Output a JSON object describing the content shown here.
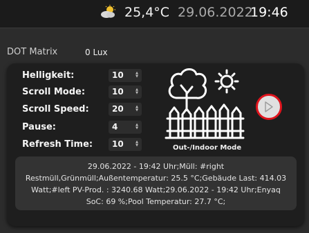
{
  "header": {
    "weather_icon": "partly-cloudy-icon",
    "temperature": "25,4°C",
    "date": "29.06.2022",
    "time": "19:46"
  },
  "dot_matrix": {
    "title": "DOT Matrix",
    "lux": "0 Lux",
    "settings": [
      {
        "label": "Helligkeit:",
        "value": "10"
      },
      {
        "label": "Scroll Mode:",
        "value": "10"
      },
      {
        "label": "Scroll Speed:",
        "value": "20"
      },
      {
        "label": "Pause:",
        "value": "4"
      },
      {
        "label": "Refresh Time:",
        "value": "10"
      }
    ],
    "mode_icon": "house-tree-sun-icon",
    "mode_caption": "Out-/Indoor Mode",
    "play_icon": "play-icon",
    "accent_color": "#e0141d",
    "message_lines": [
      "29.06.2022 - 19:42 Uhr;Müll: #right",
      "Restmüll,Grünmüll;Außentemperatur: 25.5 °C;Gebäude Last: 414.03",
      "Watt;#left PV-Prod. : 3240.68 Watt;29.06.2022 - 19:42 Uhr;Enyaq",
      "SoC: 69 %;Pool Temperatur: 27.7 °C;"
    ]
  }
}
